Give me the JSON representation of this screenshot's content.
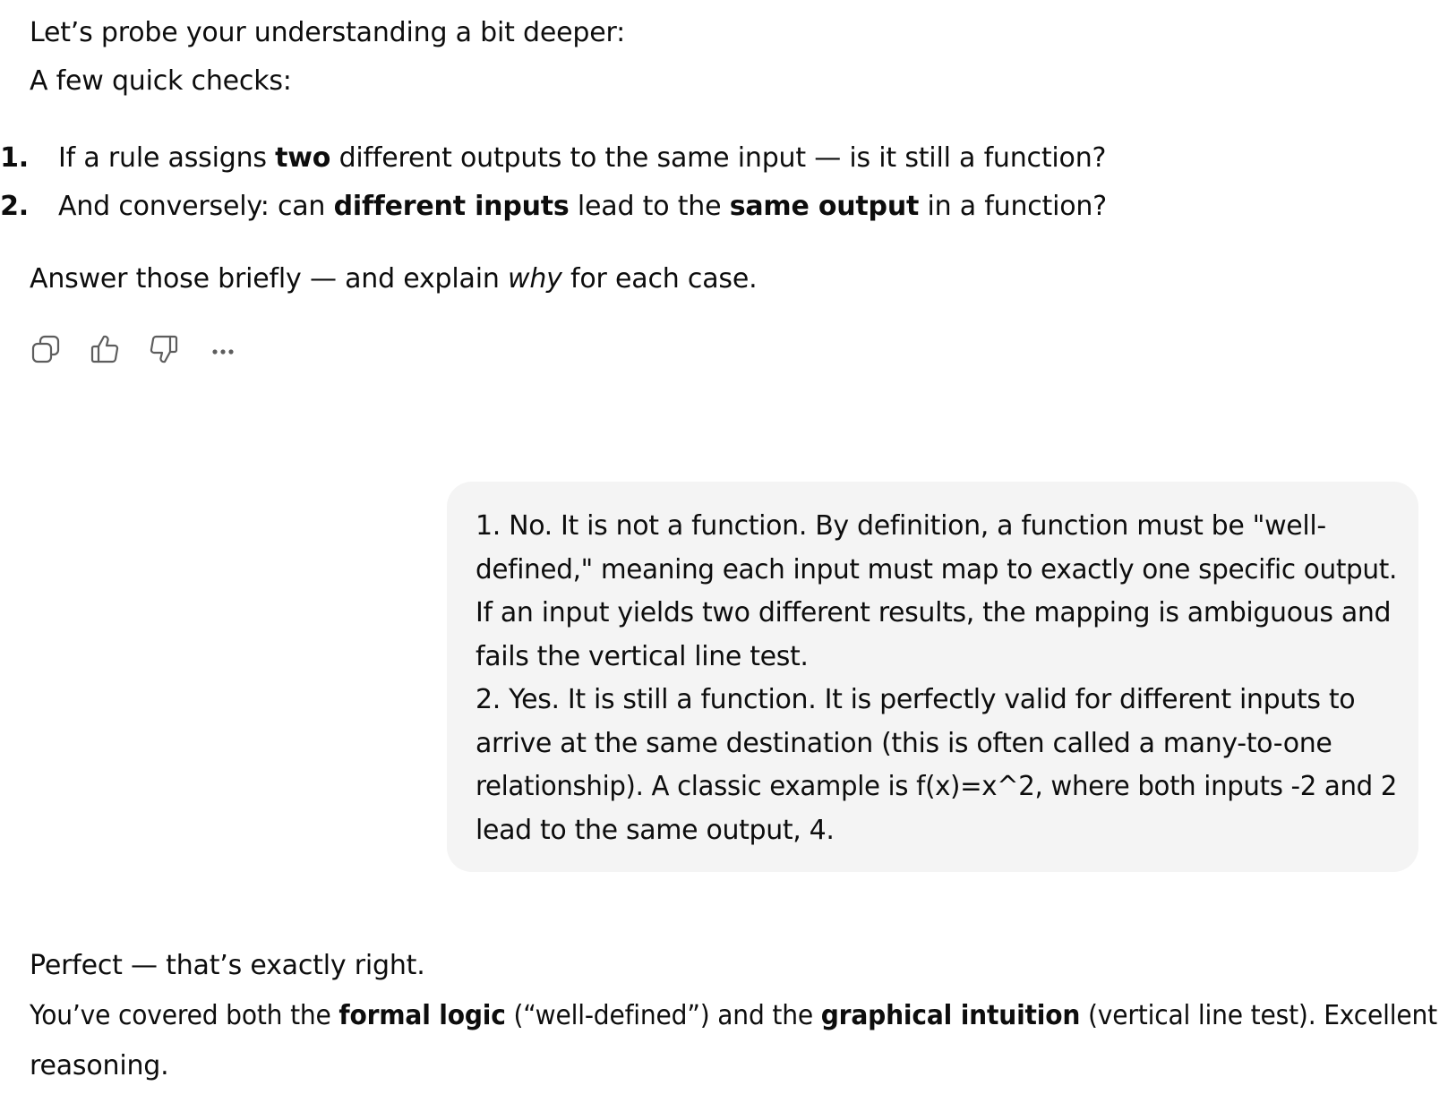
{
  "assistant_message_1": {
    "intro": "Let’s probe your understanding a bit deeper:",
    "lead": "A few quick checks:",
    "checks": [
      {
        "number": "1.",
        "parts": [
          "If a rule assigns ",
          "two",
          " different outputs to the same input — is it still a function?"
        ]
      },
      {
        "number": "2.",
        "parts": [
          "And conversely: can ",
          "different inputs",
          " lead to the ",
          "same output",
          " in a function?"
        ]
      }
    ],
    "closing": {
      "before": "Answer those briefly — and explain ",
      "emphasis": "why",
      "after": " for each case."
    },
    "actions": [
      {
        "name": "copy-icon",
        "label": "Copy"
      },
      {
        "name": "thumbs-up-icon",
        "label": "Good response"
      },
      {
        "name": "thumbs-down-icon",
        "label": "Bad response"
      },
      {
        "name": "more-options-icon",
        "label": "More"
      }
    ]
  },
  "user_message": {
    "lines": [
      "1. No. It is not a function. By definition, a function must be \"well-",
      "defined,\" meaning each input must map to exactly one specific output.",
      "If an input yields two different results, the mapping is ambiguous and",
      "fails the vertical line test.",
      "2. Yes. It is still a function. It is perfectly valid for different inputs to",
      "arrive at the same destination (this is often called a many-to-one",
      "relationship). A classic example is f(x)=x^2, where both inputs -2 and 2",
      "lead to the same output, 4."
    ]
  },
  "assistant_message_2": {
    "line1": "Perfect — that’s exactly right.",
    "line2_parts": [
      "You’ve covered both the ",
      "formal logic",
      " (“well-defined”) and the ",
      "graphical intuition",
      " (vertical line test). Excellent"
    ],
    "line3": "reasoning."
  },
  "colors": {
    "text": "#0d0d0d",
    "bubble_bg": "#f4f4f4",
    "icon": "#5d5d5d"
  }
}
